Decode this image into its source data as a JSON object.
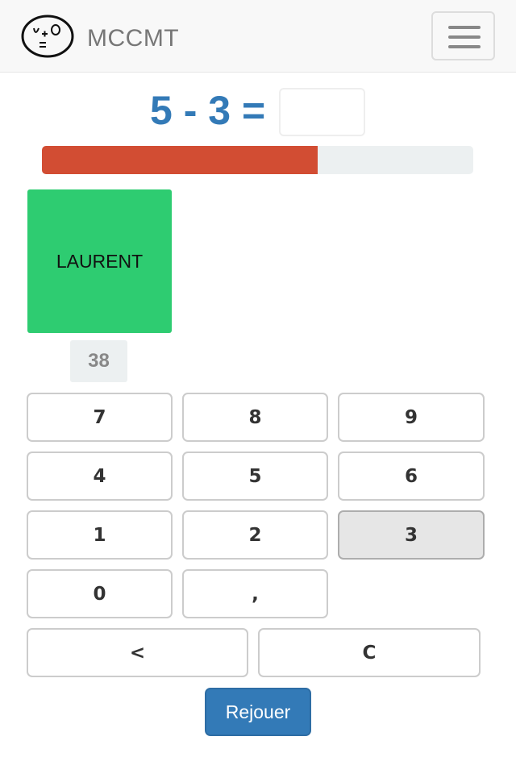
{
  "app": {
    "brand": "MCCMT",
    "logo_icon": "face-with-equation-icon"
  },
  "question": {
    "operand_a": "5",
    "operator": "-",
    "operand_b": "3",
    "equals": "=",
    "answer": ""
  },
  "progress": {
    "fraction": 0.64,
    "color": "#d24d33"
  },
  "player": {
    "name": "LAURENT",
    "score": "38",
    "card_color": "#2ecc71"
  },
  "keypad": {
    "k7": "7",
    "k8": "8",
    "k9": "9",
    "k4": "4",
    "k5": "5",
    "k6": "6",
    "k1": "1",
    "k2": "2",
    "k3": "3",
    "k0": "0",
    "comma": ",",
    "backspace": "<",
    "clear": "C"
  },
  "actions": {
    "replay_label": "Rejouer"
  },
  "colors": {
    "accent": "#337ab7",
    "keypad_active": "#e6e6e6"
  }
}
